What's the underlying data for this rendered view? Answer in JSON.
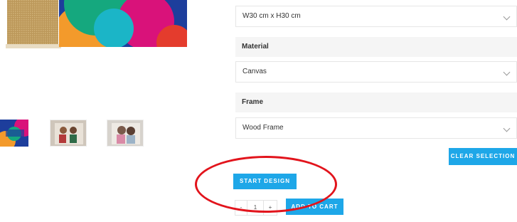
{
  "size": {
    "value": "W30 cm x H30 cm"
  },
  "material": {
    "label": "Material",
    "value": "Canvas"
  },
  "frame": {
    "label": "Frame",
    "value": "Wood Frame"
  },
  "clear_selection_label": "CLEAR SELECTION",
  "start_design_label": "START DESIGN",
  "quantity": {
    "minus": "-",
    "value": "1",
    "plus": "+"
  },
  "add_to_cart_label": "ADD TO CART",
  "colors": {
    "accent": "#1ea7e8",
    "annotation": "#e2141c"
  }
}
